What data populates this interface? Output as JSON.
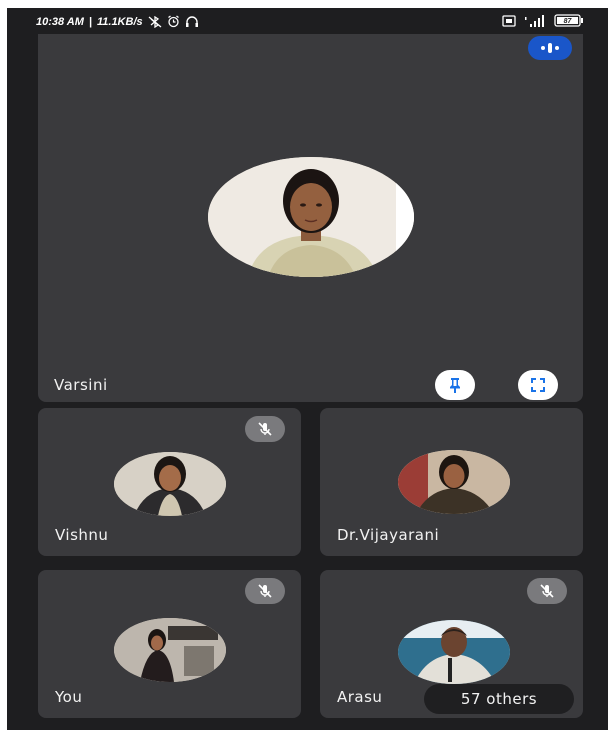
{
  "statusbar": {
    "time": "10:38 AM",
    "speed": "11.1KB/s",
    "battery": "87"
  },
  "main_tile": {
    "name": "Varsini",
    "pin_icon": "pin-icon",
    "fullscreen_icon": "fullscreen-icon",
    "audio_icon": "audio-level-icon"
  },
  "participants": [
    {
      "name": "Vishnu",
      "muted": true
    },
    {
      "name": "Dr.Vijayarani",
      "muted": false
    },
    {
      "name": "You",
      "muted": true
    },
    {
      "name": "Arasu",
      "muted": true
    }
  ],
  "others_chip": {
    "label": "57 others"
  },
  "colors": {
    "background": "#1e1e20",
    "tile": "#3a3a3d",
    "accent_blue": "#1a56c9",
    "icon_blue": "#1a73e8"
  }
}
